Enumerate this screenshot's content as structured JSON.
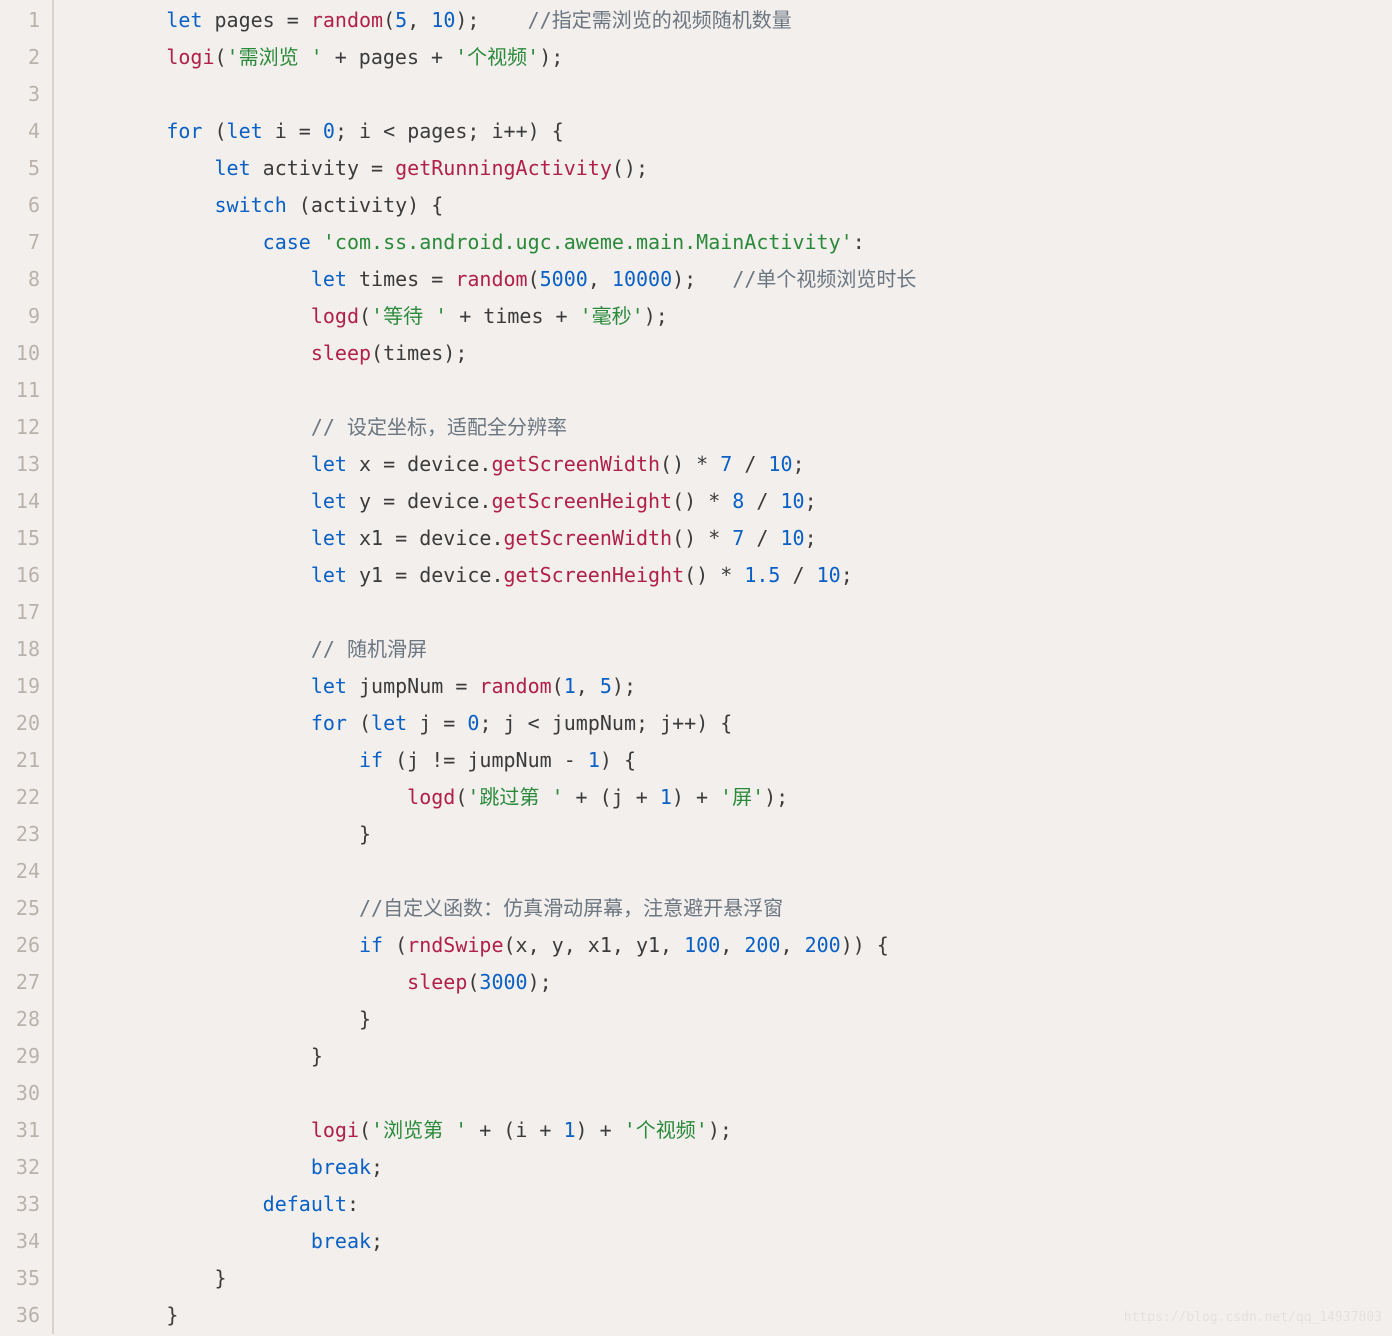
{
  "lineCount": 36,
  "watermark": "https://blog.csdn.net/qq_14937803",
  "tokens": {
    "l1": [
      {
        "t": "        ",
        "c": ""
      },
      {
        "t": "let",
        "c": "kw"
      },
      {
        "t": " pages ",
        "c": ""
      },
      {
        "t": "=",
        "c": "op"
      },
      {
        "t": " ",
        "c": ""
      },
      {
        "t": "random",
        "c": "func"
      },
      {
        "t": "(",
        "c": "op"
      },
      {
        "t": "5",
        "c": "num"
      },
      {
        "t": ", ",
        "c": "op"
      },
      {
        "t": "10",
        "c": "num"
      },
      {
        "t": ");",
        "c": "op"
      },
      {
        "t": "    ",
        "c": ""
      },
      {
        "t": "//指定需浏览的视频随机数量",
        "c": "cm"
      }
    ],
    "l2": [
      {
        "t": "        ",
        "c": ""
      },
      {
        "t": "logi",
        "c": "func"
      },
      {
        "t": "(",
        "c": "op"
      },
      {
        "t": "'需浏览 '",
        "c": "str"
      },
      {
        "t": " + pages + ",
        "c": ""
      },
      {
        "t": "'个视频'",
        "c": "str"
      },
      {
        "t": ");",
        "c": "op"
      }
    ],
    "l3": [
      {
        "t": "",
        "c": ""
      }
    ],
    "l4": [
      {
        "t": "        ",
        "c": ""
      },
      {
        "t": "for",
        "c": "kw"
      },
      {
        "t": " (",
        "c": "op"
      },
      {
        "t": "let",
        "c": "kw"
      },
      {
        "t": " i ",
        "c": ""
      },
      {
        "t": "=",
        "c": "op"
      },
      {
        "t": " ",
        "c": ""
      },
      {
        "t": "0",
        "c": "num"
      },
      {
        "t": "; i ",
        "c": ""
      },
      {
        "t": "<",
        "c": "op"
      },
      {
        "t": " pages; i",
        "c": ""
      },
      {
        "t": "++",
        "c": "op"
      },
      {
        "t": ") {",
        "c": "op"
      }
    ],
    "l5": [
      {
        "t": "            ",
        "c": ""
      },
      {
        "t": "let",
        "c": "kw"
      },
      {
        "t": " activity ",
        "c": ""
      },
      {
        "t": "=",
        "c": "op"
      },
      {
        "t": " ",
        "c": ""
      },
      {
        "t": "getRunningActivity",
        "c": "func"
      },
      {
        "t": "();",
        "c": "op"
      }
    ],
    "l6": [
      {
        "t": "            ",
        "c": ""
      },
      {
        "t": "switch",
        "c": "kw"
      },
      {
        "t": " (activity) {",
        "c": "op"
      }
    ],
    "l7": [
      {
        "t": "                ",
        "c": ""
      },
      {
        "t": "case",
        "c": "kw"
      },
      {
        "t": " ",
        "c": ""
      },
      {
        "t": "'com.ss.android.ugc.aweme.main.MainActivity'",
        "c": "str"
      },
      {
        "t": ":",
        "c": "op"
      }
    ],
    "l8": [
      {
        "t": "                    ",
        "c": ""
      },
      {
        "t": "let",
        "c": "kw"
      },
      {
        "t": " times ",
        "c": ""
      },
      {
        "t": "=",
        "c": "op"
      },
      {
        "t": " ",
        "c": ""
      },
      {
        "t": "random",
        "c": "func"
      },
      {
        "t": "(",
        "c": "op"
      },
      {
        "t": "5000",
        "c": "num"
      },
      {
        "t": ", ",
        "c": "op"
      },
      {
        "t": "10000",
        "c": "num"
      },
      {
        "t": ");",
        "c": "op"
      },
      {
        "t": "   ",
        "c": ""
      },
      {
        "t": "//单个视频浏览时长",
        "c": "cm"
      }
    ],
    "l9": [
      {
        "t": "                    ",
        "c": ""
      },
      {
        "t": "logd",
        "c": "func"
      },
      {
        "t": "(",
        "c": "op"
      },
      {
        "t": "'等待 '",
        "c": "str"
      },
      {
        "t": " + times + ",
        "c": ""
      },
      {
        "t": "'毫秒'",
        "c": "str"
      },
      {
        "t": ");",
        "c": "op"
      }
    ],
    "l10": [
      {
        "t": "                    ",
        "c": ""
      },
      {
        "t": "sleep",
        "c": "func"
      },
      {
        "t": "(times);",
        "c": "op"
      }
    ],
    "l11": [
      {
        "t": "",
        "c": ""
      }
    ],
    "l12": [
      {
        "t": "                    ",
        "c": ""
      },
      {
        "t": "// 设定坐标，适配全分辨率",
        "c": "cm"
      }
    ],
    "l13": [
      {
        "t": "                    ",
        "c": ""
      },
      {
        "t": "let",
        "c": "kw"
      },
      {
        "t": " x ",
        "c": ""
      },
      {
        "t": "=",
        "c": "op"
      },
      {
        "t": " device.",
        "c": ""
      },
      {
        "t": "getScreenWidth",
        "c": "prop"
      },
      {
        "t": "() ",
        "c": "op"
      },
      {
        "t": "*",
        "c": "op"
      },
      {
        "t": " ",
        "c": ""
      },
      {
        "t": "7",
        "c": "num"
      },
      {
        "t": " / ",
        "c": ""
      },
      {
        "t": "10",
        "c": "num"
      },
      {
        "t": ";",
        "c": "op"
      }
    ],
    "l14": [
      {
        "t": "                    ",
        "c": ""
      },
      {
        "t": "let",
        "c": "kw"
      },
      {
        "t": " y ",
        "c": ""
      },
      {
        "t": "=",
        "c": "op"
      },
      {
        "t": " device.",
        "c": ""
      },
      {
        "t": "getScreenHeight",
        "c": "prop"
      },
      {
        "t": "() ",
        "c": "op"
      },
      {
        "t": "*",
        "c": "op"
      },
      {
        "t": " ",
        "c": ""
      },
      {
        "t": "8",
        "c": "num"
      },
      {
        "t": " / ",
        "c": ""
      },
      {
        "t": "10",
        "c": "num"
      },
      {
        "t": ";",
        "c": "op"
      }
    ],
    "l15": [
      {
        "t": "                    ",
        "c": ""
      },
      {
        "t": "let",
        "c": "kw"
      },
      {
        "t": " x1 ",
        "c": ""
      },
      {
        "t": "=",
        "c": "op"
      },
      {
        "t": " device.",
        "c": ""
      },
      {
        "t": "getScreenWidth",
        "c": "prop"
      },
      {
        "t": "() ",
        "c": "op"
      },
      {
        "t": "*",
        "c": "op"
      },
      {
        "t": " ",
        "c": ""
      },
      {
        "t": "7",
        "c": "num"
      },
      {
        "t": " / ",
        "c": ""
      },
      {
        "t": "10",
        "c": "num"
      },
      {
        "t": ";",
        "c": "op"
      }
    ],
    "l16": [
      {
        "t": "                    ",
        "c": ""
      },
      {
        "t": "let",
        "c": "kw"
      },
      {
        "t": " y1 ",
        "c": ""
      },
      {
        "t": "=",
        "c": "op"
      },
      {
        "t": " device.",
        "c": ""
      },
      {
        "t": "getScreenHeight",
        "c": "prop"
      },
      {
        "t": "() ",
        "c": "op"
      },
      {
        "t": "*",
        "c": "op"
      },
      {
        "t": " ",
        "c": ""
      },
      {
        "t": "1.5",
        "c": "num"
      },
      {
        "t": " / ",
        "c": ""
      },
      {
        "t": "10",
        "c": "num"
      },
      {
        "t": ";",
        "c": "op"
      }
    ],
    "l17": [
      {
        "t": "",
        "c": ""
      }
    ],
    "l18": [
      {
        "t": "                    ",
        "c": ""
      },
      {
        "t": "// 随机滑屏",
        "c": "cm"
      }
    ],
    "l19": [
      {
        "t": "                    ",
        "c": ""
      },
      {
        "t": "let",
        "c": "kw"
      },
      {
        "t": " jumpNum ",
        "c": ""
      },
      {
        "t": "=",
        "c": "op"
      },
      {
        "t": " ",
        "c": ""
      },
      {
        "t": "random",
        "c": "func"
      },
      {
        "t": "(",
        "c": "op"
      },
      {
        "t": "1",
        "c": "num"
      },
      {
        "t": ", ",
        "c": "op"
      },
      {
        "t": "5",
        "c": "num"
      },
      {
        "t": ");",
        "c": "op"
      }
    ],
    "l20": [
      {
        "t": "                    ",
        "c": ""
      },
      {
        "t": "for",
        "c": "kw"
      },
      {
        "t": " (",
        "c": "op"
      },
      {
        "t": "let",
        "c": "kw"
      },
      {
        "t": " j ",
        "c": ""
      },
      {
        "t": "=",
        "c": "op"
      },
      {
        "t": " ",
        "c": ""
      },
      {
        "t": "0",
        "c": "num"
      },
      {
        "t": "; j ",
        "c": ""
      },
      {
        "t": "<",
        "c": "op"
      },
      {
        "t": " jumpNum; j",
        "c": ""
      },
      {
        "t": "++",
        "c": "op"
      },
      {
        "t": ") {",
        "c": "op"
      }
    ],
    "l21": [
      {
        "t": "                        ",
        "c": ""
      },
      {
        "t": "if",
        "c": "kw"
      },
      {
        "t": " (j ",
        "c": "op"
      },
      {
        "t": "!=",
        "c": "op"
      },
      {
        "t": " jumpNum ",
        "c": ""
      },
      {
        "t": "-",
        "c": "op"
      },
      {
        "t": " ",
        "c": ""
      },
      {
        "t": "1",
        "c": "num"
      },
      {
        "t": ") {",
        "c": "op"
      }
    ],
    "l22": [
      {
        "t": "                            ",
        "c": ""
      },
      {
        "t": "logd",
        "c": "func"
      },
      {
        "t": "(",
        "c": "op"
      },
      {
        "t": "'跳过第 '",
        "c": "str"
      },
      {
        "t": " + (j + ",
        "c": ""
      },
      {
        "t": "1",
        "c": "num"
      },
      {
        "t": ") + ",
        "c": ""
      },
      {
        "t": "'屏'",
        "c": "str"
      },
      {
        "t": ");",
        "c": "op"
      }
    ],
    "l23": [
      {
        "t": "                        }",
        "c": "op"
      }
    ],
    "l24": [
      {
        "t": "",
        "c": ""
      }
    ],
    "l25": [
      {
        "t": "                        ",
        "c": ""
      },
      {
        "t": "//自定义函数：仿真滑动屏幕，注意避开悬浮窗",
        "c": "cm"
      }
    ],
    "l26": [
      {
        "t": "                        ",
        "c": ""
      },
      {
        "t": "if",
        "c": "kw"
      },
      {
        "t": " (",
        "c": "op"
      },
      {
        "t": "rndSwipe",
        "c": "func"
      },
      {
        "t": "(x, y, x1, y1, ",
        "c": "op"
      },
      {
        "t": "100",
        "c": "num"
      },
      {
        "t": ", ",
        "c": "op"
      },
      {
        "t": "200",
        "c": "num"
      },
      {
        "t": ", ",
        "c": "op"
      },
      {
        "t": "200",
        "c": "num"
      },
      {
        "t": ")) {",
        "c": "op"
      }
    ],
    "l27": [
      {
        "t": "                            ",
        "c": ""
      },
      {
        "t": "sleep",
        "c": "func"
      },
      {
        "t": "(",
        "c": "op"
      },
      {
        "t": "3000",
        "c": "num"
      },
      {
        "t": ");",
        "c": "op"
      }
    ],
    "l28": [
      {
        "t": "                        }",
        "c": "op"
      }
    ],
    "l29": [
      {
        "t": "                    }",
        "c": "op"
      }
    ],
    "l30": [
      {
        "t": "",
        "c": ""
      }
    ],
    "l31": [
      {
        "t": "                    ",
        "c": ""
      },
      {
        "t": "logi",
        "c": "func"
      },
      {
        "t": "(",
        "c": "op"
      },
      {
        "t": "'浏览第 '",
        "c": "str"
      },
      {
        "t": " + (i + ",
        "c": ""
      },
      {
        "t": "1",
        "c": "num"
      },
      {
        "t": ") + ",
        "c": ""
      },
      {
        "t": "'个视频'",
        "c": "str"
      },
      {
        "t": ");",
        "c": "op"
      }
    ],
    "l32": [
      {
        "t": "                    ",
        "c": ""
      },
      {
        "t": "break",
        "c": "kw"
      },
      {
        "t": ";",
        "c": "op"
      }
    ],
    "l33": [
      {
        "t": "                ",
        "c": ""
      },
      {
        "t": "default",
        "c": "kw"
      },
      {
        "t": ":",
        "c": "op"
      }
    ],
    "l34": [
      {
        "t": "                    ",
        "c": ""
      },
      {
        "t": "break",
        "c": "kw"
      },
      {
        "t": ";",
        "c": "op"
      }
    ],
    "l35": [
      {
        "t": "            }",
        "c": "op"
      }
    ],
    "l36": [
      {
        "t": "        }",
        "c": "op"
      }
    ]
  }
}
